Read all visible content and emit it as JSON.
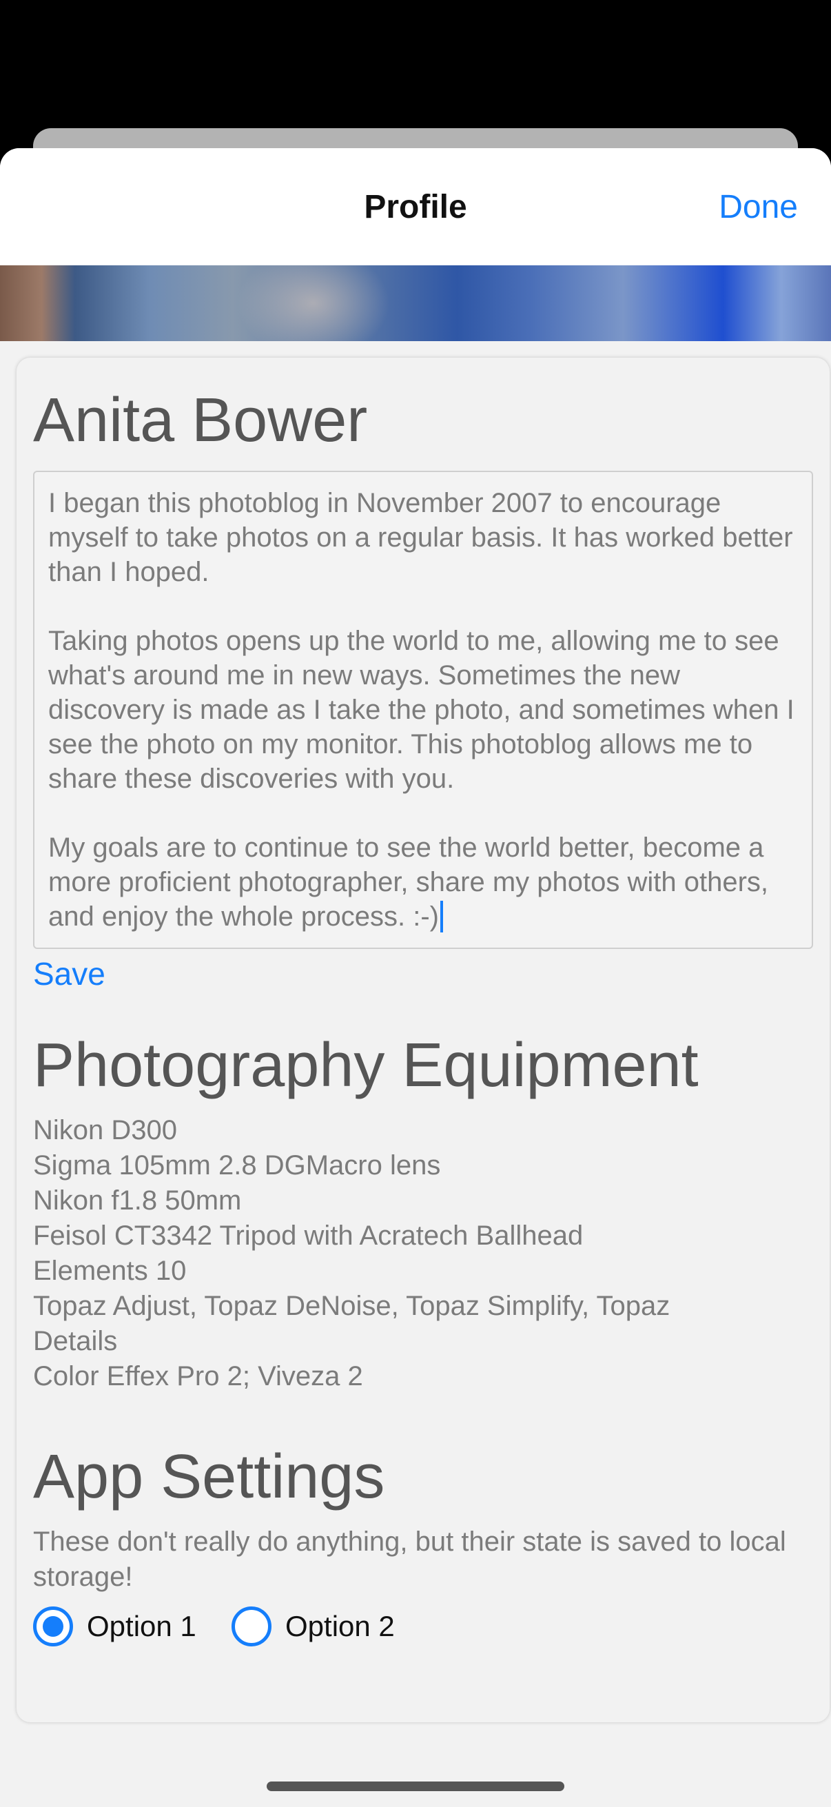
{
  "nav": {
    "title": "Profile",
    "done_label": "Done"
  },
  "profile": {
    "name": "Anita Bower",
    "bio": "I began this photoblog in November 2007 to encourage myself to take photos on a regular basis. It has worked better than I hoped.\n\nTaking photos opens up the world to me, allowing me to see what's around me in new ways. Sometimes the new discovery is made as I take the photo, and sometimes when I see the photo on my monitor. This photoblog allows me to share these discoveries with you.\n\nMy goals are to continue to see the world better, become a more proficient photographer, share my photos with others, and enjoy the whole process. :-)",
    "save_label": "Save"
  },
  "equipment": {
    "heading": "Photography Equipment",
    "items": [
      "Nikon D300",
      "Sigma 105mm 2.8 DGMacro lens",
      "Nikon f1.8 50mm",
      "Feisol CT3342 Tripod with Acratech Ballhead",
      "Elements 10",
      "Topaz Adjust, Topaz DeNoise, Topaz Simplify, Topaz",
      "Details",
      "Color Effex Pro 2; Viveza 2"
    ]
  },
  "settings": {
    "heading": "App Settings",
    "description": "These don't really do anything, but their state is saved to local storage!",
    "options": [
      {
        "label": "Option 1",
        "checked": true
      },
      {
        "label": "Option 2",
        "checked": false
      }
    ]
  },
  "colors": {
    "accent": "#157efb",
    "heading_text": "#555555",
    "body_text": "#7b7b7b"
  }
}
